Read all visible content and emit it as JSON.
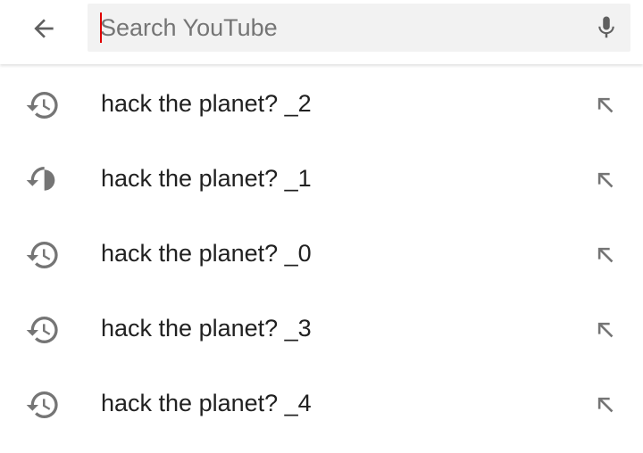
{
  "search": {
    "placeholder": "Search YouTube",
    "value": ""
  },
  "icons": {
    "back": "arrow-back-icon",
    "mic": "microphone-icon",
    "history": "history-icon",
    "fill": "arrow-up-left-icon"
  },
  "colors": {
    "caret": "#e00000",
    "icon": "#757575",
    "search_bg": "#f2f2f2"
  },
  "suggestions": [
    {
      "label": "hack the planet? _2"
    },
    {
      "label": "hack the planet? _1"
    },
    {
      "label": "hack the planet? _0"
    },
    {
      "label": "hack the planet? _3"
    },
    {
      "label": "hack the planet? _4"
    }
  ]
}
